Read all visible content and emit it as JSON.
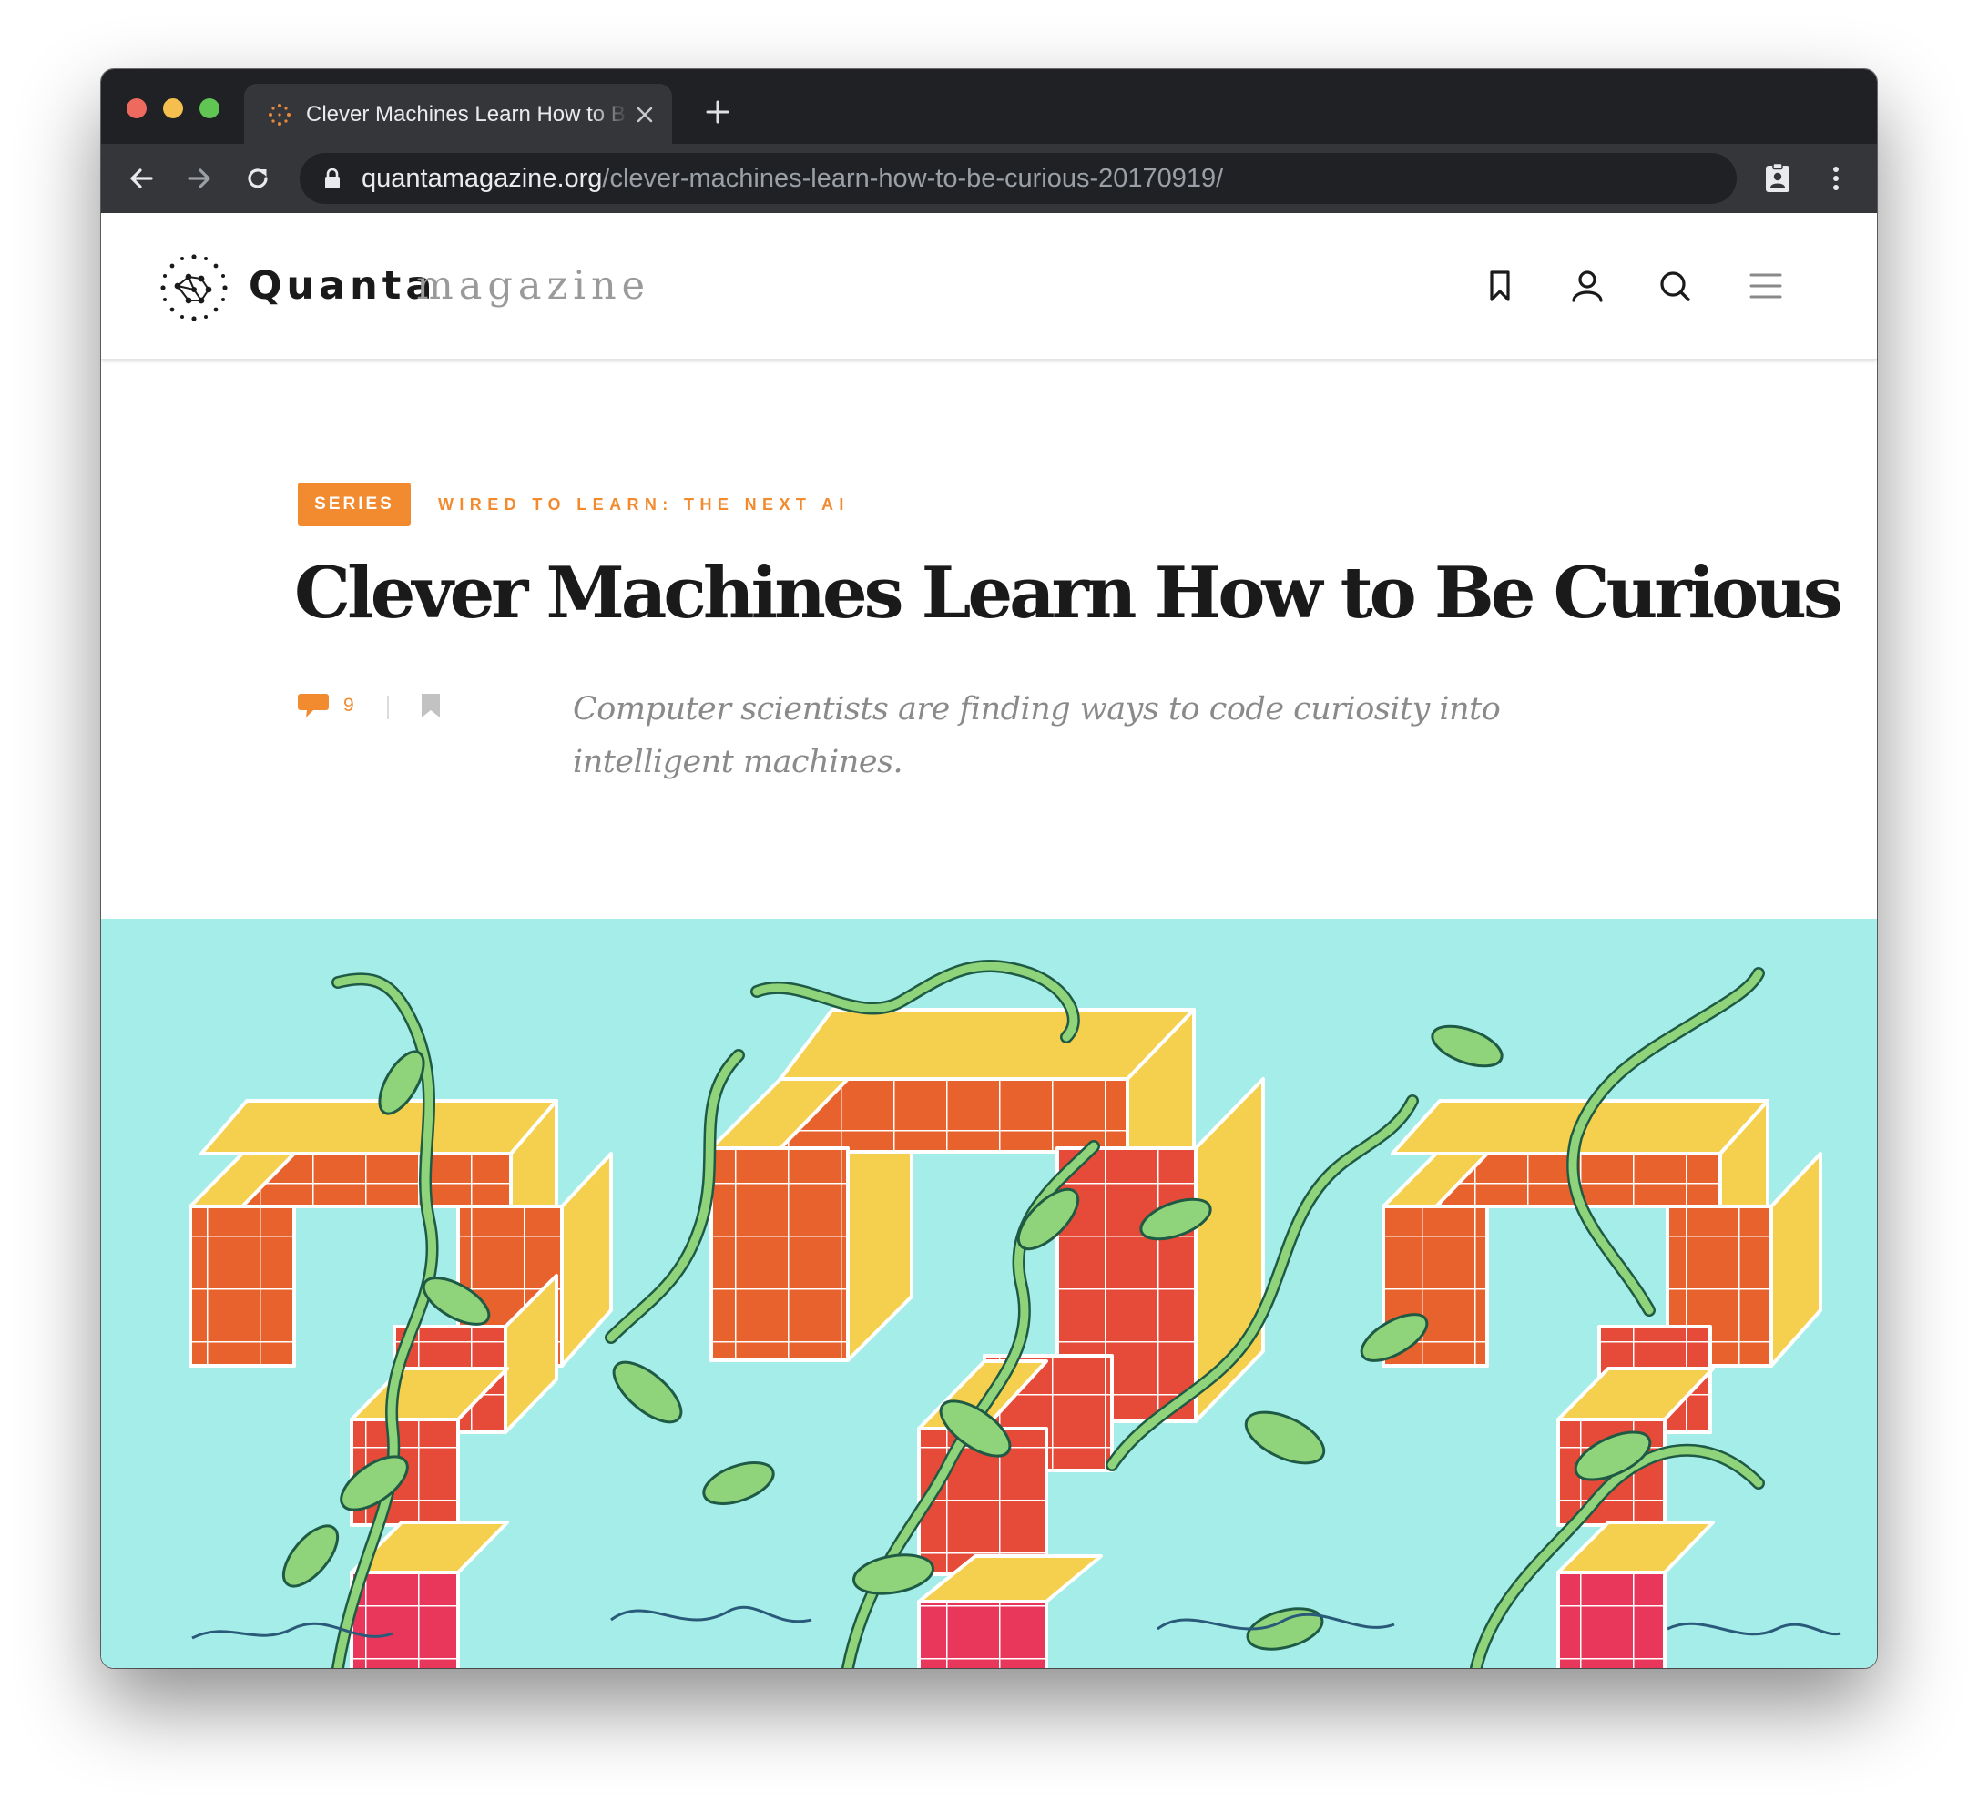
{
  "browser": {
    "tab": {
      "title": "Clever Machines Learn How to Be Curious"
    },
    "address_bar": {
      "host": "quantamagazine.org",
      "path": "/clever-machines-learn-how-to-be-curious-20170919/"
    }
  },
  "site": {
    "logo": {
      "name_primary": "Quanta",
      "name_secondary": "magazine"
    },
    "header_icons": [
      "bookmark-icon",
      "user-icon",
      "search-icon",
      "menu-icon"
    ]
  },
  "article": {
    "series_badge": "SERIES",
    "series_title": "WIRED TO LEARN: THE NEXT AI",
    "headline": "Clever Machines Learn How to Be Curious",
    "comment_count": "9",
    "dek": "Computer scientists are finding ways to code curiosity into intelligent machines."
  },
  "colors": {
    "accent": "#f28b30",
    "chrome_dark": "#202124",
    "chrome_tab": "#35363a",
    "hero_background": "#a5ede8",
    "block_orange": "#e8622e",
    "block_yellow": "#f5d04f",
    "vine_green": "#8fd47a"
  }
}
